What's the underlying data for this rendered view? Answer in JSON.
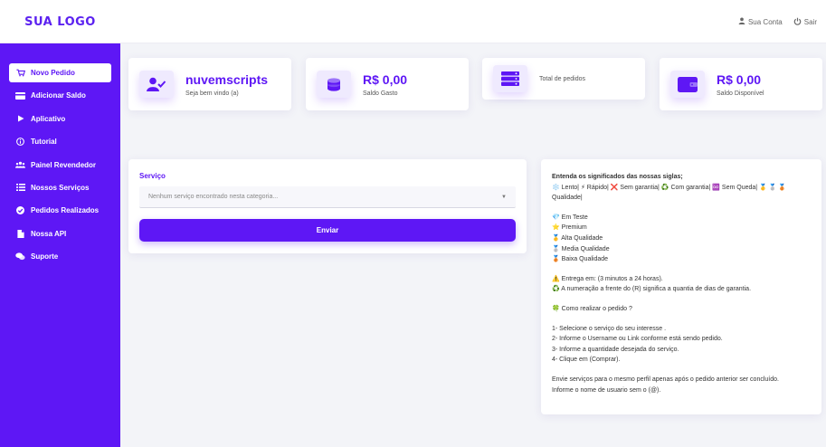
{
  "brand": {
    "logo": "SUA LOGO"
  },
  "header": {
    "account_label": "Sua Conta",
    "logout_label": "Sair"
  },
  "sidebar": {
    "items": [
      {
        "label": "Novo Pedido",
        "icon": "cart-icon"
      },
      {
        "label": "Adicionar Saldo",
        "icon": "card-icon"
      },
      {
        "label": "Aplicativo",
        "icon": "play-icon"
      },
      {
        "label": "Tutorial",
        "icon": "info-icon"
      },
      {
        "label": "Painel Revendedor",
        "icon": "users-icon"
      },
      {
        "label": "Nossos Serviços",
        "icon": "list-icon"
      },
      {
        "label": "Pedidos Realizados",
        "icon": "check-icon"
      },
      {
        "label": "Nossa API",
        "icon": "file-icon"
      },
      {
        "label": "Suporte",
        "icon": "chat-icon"
      }
    ]
  },
  "stats": [
    {
      "big": "nuvemscripts",
      "sub": "Seja bem vindo (a)",
      "icon": "user-check-icon"
    },
    {
      "big": "R$ 0,00",
      "sub": "Saldo Gasto",
      "icon": "coins-icon"
    },
    {
      "big": "",
      "sub": "Total de pedidos",
      "icon": "server-icon"
    },
    {
      "big": "R$ 0,00",
      "sub": "Saldo Disponível",
      "icon": "wallet-icon"
    }
  ],
  "order_form": {
    "service_label": "Serviço",
    "service_placeholder": "Nenhum serviço encontrado nesta categoria...",
    "submit_label": "Enviar"
  },
  "info": {
    "title": "Entenda os significados das nossas siglas;",
    "legend": "❄️ Lento| ⚡ Rápido| ❌ Sem garantia| ♻️ Com garantia| ♾️ Sem Queda| 🥇 🥈 🥉 Qualidade|",
    "types": [
      "💎 Em Teste",
      "⭐ Premium",
      "🥇 Alta Qualidade",
      "🥈 Media Qualidade",
      "🥉 Baixa Qualidade"
    ],
    "notes": [
      "⚠️ Entrega em: (3 minutos a 24 horas).",
      "♻️ A numeração a frente do (R) significa a quantia de dias de garantia."
    ],
    "howto_title": "🍀 Como realizar o pedido ?",
    "steps": [
      "1- Selecione o serviço do seu interesse .",
      "2- Informe o Username ou Link conforme está sendo pedido.",
      "3- Informe a quantidade desejada do serviço.",
      "4- Clique em (Comprar)."
    ],
    "footer": [
      "Envie serviços para o mesmo perfil apenas após o pedido anterior ser concluído.",
      "Informe o nome de usuario sem o (@)."
    ]
  },
  "colors": {
    "accent": "#5e17f5",
    "background": "#f3f4f8"
  }
}
